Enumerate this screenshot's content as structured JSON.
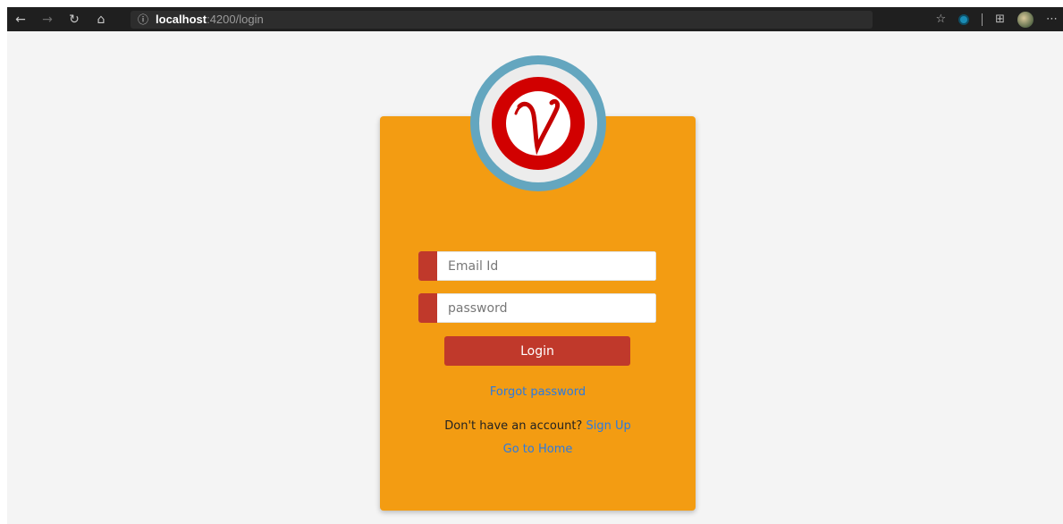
{
  "browser": {
    "back_icon": "←",
    "forward_icon": "→",
    "reload_icon": "↻",
    "home_icon": "⌂",
    "info_icon": "ⓘ",
    "url_host": "localhost",
    "url_path": ":4200/login",
    "favorite_icon": "☆",
    "collections_icon": "⊞",
    "more_icon": "⋯"
  },
  "login": {
    "email_placeholder": "Email Id",
    "password_placeholder": "password",
    "login_label": "Login",
    "forgot_label": "Forgot password",
    "no_account_text": "Don't have an account?",
    "signup_label": "Sign Up",
    "home_label": "Go to Home"
  },
  "colors": {
    "card": "#f39c12",
    "accent": "#c0392b",
    "logo_ring": "#64a6bf",
    "logo_red": "#d10000",
    "link": "#2a7ae2"
  }
}
